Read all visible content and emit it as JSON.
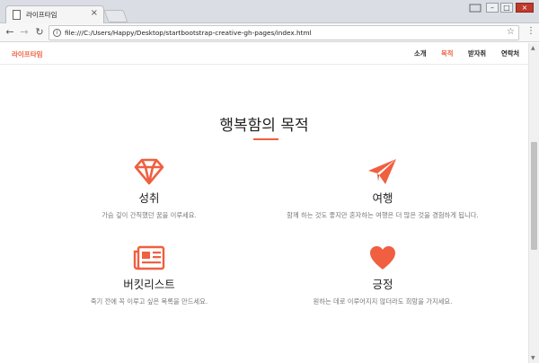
{
  "browser": {
    "tab_title": "라이프타임",
    "tab_close": "×",
    "url": "file:///C:/Users/Happy/Desktop/startbootstrap-creative-gh-pages/index.html",
    "back": "←",
    "forward": "→",
    "reload": "↻",
    "star": "☆",
    "menu": "⋮",
    "minimize": "–",
    "maximize": "□",
    "close": "×"
  },
  "site": {
    "brand": "라이프타임",
    "nav": [
      {
        "label": "소개",
        "active": false
      },
      {
        "label": "목적",
        "active": true
      },
      {
        "label": "받자취",
        "active": false
      },
      {
        "label": "연락처",
        "active": false
      }
    ]
  },
  "section": {
    "title": "행복함의 목적",
    "features": [
      {
        "icon": "diamond-icon",
        "title": "성취",
        "desc": "가슴 깊이 간직했던 꿈을 이루세요."
      },
      {
        "icon": "paper-plane-icon",
        "title": "여행",
        "desc": "함께 하는 것도 좋지만 혼자하는 여행은 더 많은 것을 경험하게 됩니다."
      },
      {
        "icon": "newspaper-icon",
        "title": "버킷리스트",
        "desc": "죽기 전에 꼭 이루고 싶은 목록을 만드세요."
      },
      {
        "icon": "heart-icon",
        "title": "긍정",
        "desc": "원하는 데로 이루어지지 않더라도 희망을 가지세요."
      }
    ]
  },
  "colors": {
    "accent": "#f05f40",
    "text": "#222222",
    "muted": "#777777"
  }
}
